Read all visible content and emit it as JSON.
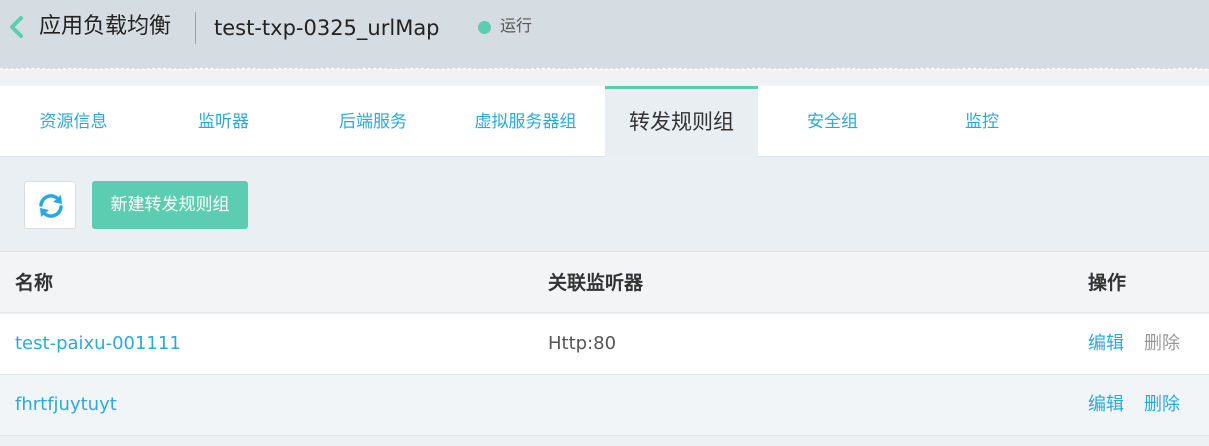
{
  "header": {
    "title": "应用负载均衡",
    "instance_name": "test-txp-0325_urlMap",
    "status": "运行",
    "status_color": "#5ccdb0"
  },
  "tabs": [
    {
      "label": "资源信息",
      "active": false
    },
    {
      "label": "监听器",
      "active": false
    },
    {
      "label": "后端服务",
      "active": false
    },
    {
      "label": "虚拟服务器组",
      "active": false
    },
    {
      "label": "转发规则组",
      "active": true
    },
    {
      "label": "安全组",
      "active": false
    },
    {
      "label": "监控",
      "active": false
    }
  ],
  "toolbar": {
    "refresh_icon": "refresh-icon",
    "new_button_label": "新建转发规则组"
  },
  "table": {
    "columns": [
      "名称",
      "关联监听器",
      "操作"
    ],
    "rows": [
      {
        "name": "test-paixu-001111",
        "listener": "Http:80",
        "edit": "编辑",
        "delete": "删除",
        "delete_enabled": false
      },
      {
        "name": "fhrtfjuytuyt",
        "listener": "",
        "edit": "编辑",
        "delete": "删除",
        "delete_enabled": true
      }
    ]
  },
  "colors": {
    "accent": "#5ccdb0",
    "link": "#2aa9e0"
  }
}
